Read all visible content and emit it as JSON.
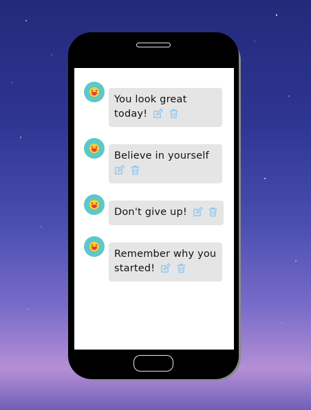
{
  "messages": [
    {
      "text": "You look great today!",
      "edit_icon": "edit-icon",
      "delete_icon": "trash-icon"
    },
    {
      "text": "Believe in yourself",
      "edit_icon": "edit-icon",
      "delete_icon": "trash-icon"
    },
    {
      "text": "Don't give up!",
      "edit_icon": "edit-icon",
      "delete_icon": "trash-icon"
    },
    {
      "text": "Remember why you started!",
      "edit_icon": "edit-icon",
      "delete_icon": "trash-icon"
    }
  ],
  "avatar_icon": "laughing-emoji-icon",
  "colors": {
    "icon_blue": "#8ec8f2",
    "bubble": "#e5e5e5",
    "avatar_bg": "#5ec7c7"
  }
}
